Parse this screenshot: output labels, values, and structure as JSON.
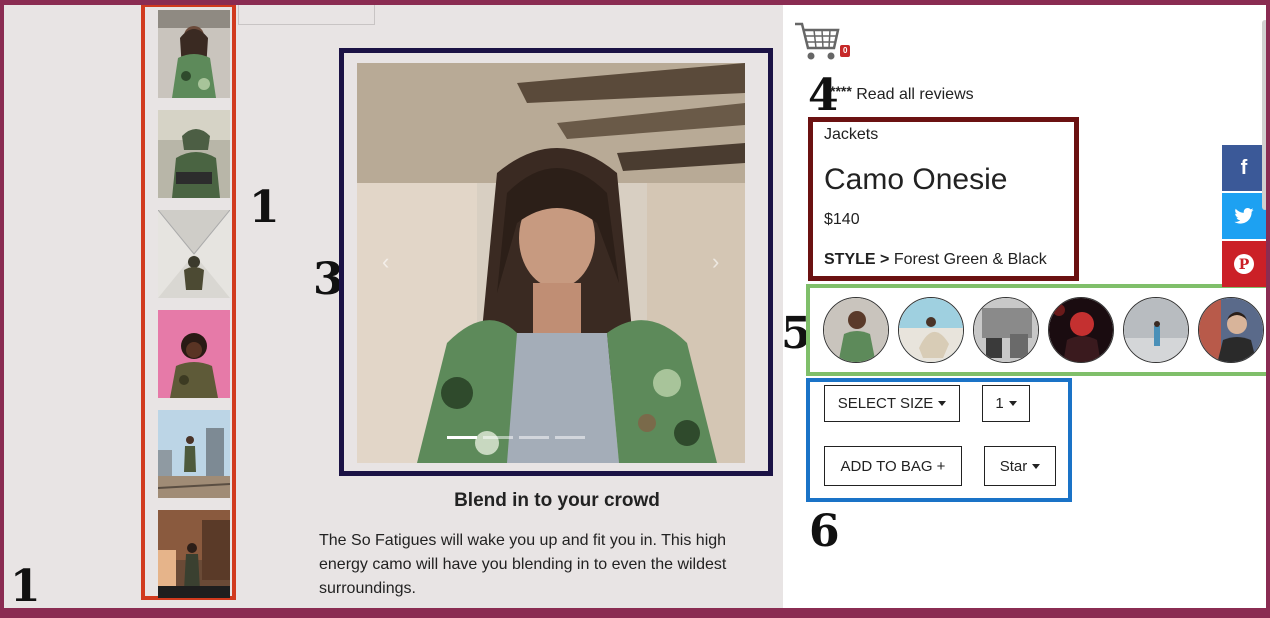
{
  "annotations": {
    "thumbs": "1",
    "corner": "1",
    "carousel": "3",
    "reviews": "4",
    "swatches": "5",
    "controls": "6"
  },
  "cart": {
    "count": "0",
    "icon": "cart-icon"
  },
  "reviews": {
    "stars": "****",
    "link": "Read all reviews"
  },
  "product": {
    "category": "Jackets",
    "title": "Camo Onesie",
    "price": "$140",
    "style_label": "STYLE >",
    "style_value": "Forest Green & Black"
  },
  "carousel": {
    "prev": "‹",
    "next": "›"
  },
  "tagline": "Blend in to your crowd",
  "description": "The So Fatigues will wake you up and fit you in. This high energy camo will have you blending in to even the wildest surroundings.",
  "controls": {
    "size_label": "SELECT SIZE",
    "qty_label": "1",
    "add_label": "ADD TO BAG +",
    "star_label": "Star"
  },
  "social": {
    "facebook": "f",
    "twitter": "t",
    "pinterest": "P"
  },
  "colors": {
    "frame": "#8a2c52",
    "thumbs_border": "#d13a1e",
    "carousel_border": "#1b1245",
    "info_border": "#6b1111",
    "swatch_border": "#7fbf6a",
    "controls_border": "#1a73c7",
    "facebook": "#3b5998",
    "twitter": "#1da1f2",
    "pinterest": "#cb2027"
  }
}
